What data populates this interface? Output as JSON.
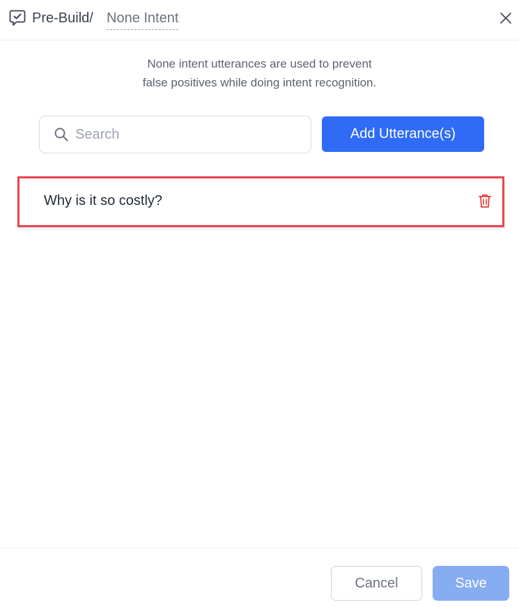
{
  "header": {
    "icon": "chat-check-icon",
    "breadcrumb_parent": "Pre-Build/",
    "breadcrumb_current": "None Intent",
    "close_icon": "close-icon"
  },
  "description": {
    "line1": "None intent utterances are used to prevent",
    "line2": "false positives while doing intent recognition."
  },
  "search": {
    "icon": "search-icon",
    "placeholder": "Search",
    "value": ""
  },
  "add_button_label": "Add Utterance(s)",
  "utterances": [
    {
      "text": "Why is it so costly?",
      "delete_icon": "trash-icon",
      "highlighted": true
    }
  ],
  "footer": {
    "cancel_label": "Cancel",
    "save_label": "Save"
  },
  "colors": {
    "primary": "#2f6bf5",
    "primary_disabled": "#86acf2",
    "highlight": "#e8444d",
    "delete": "#e53935"
  }
}
